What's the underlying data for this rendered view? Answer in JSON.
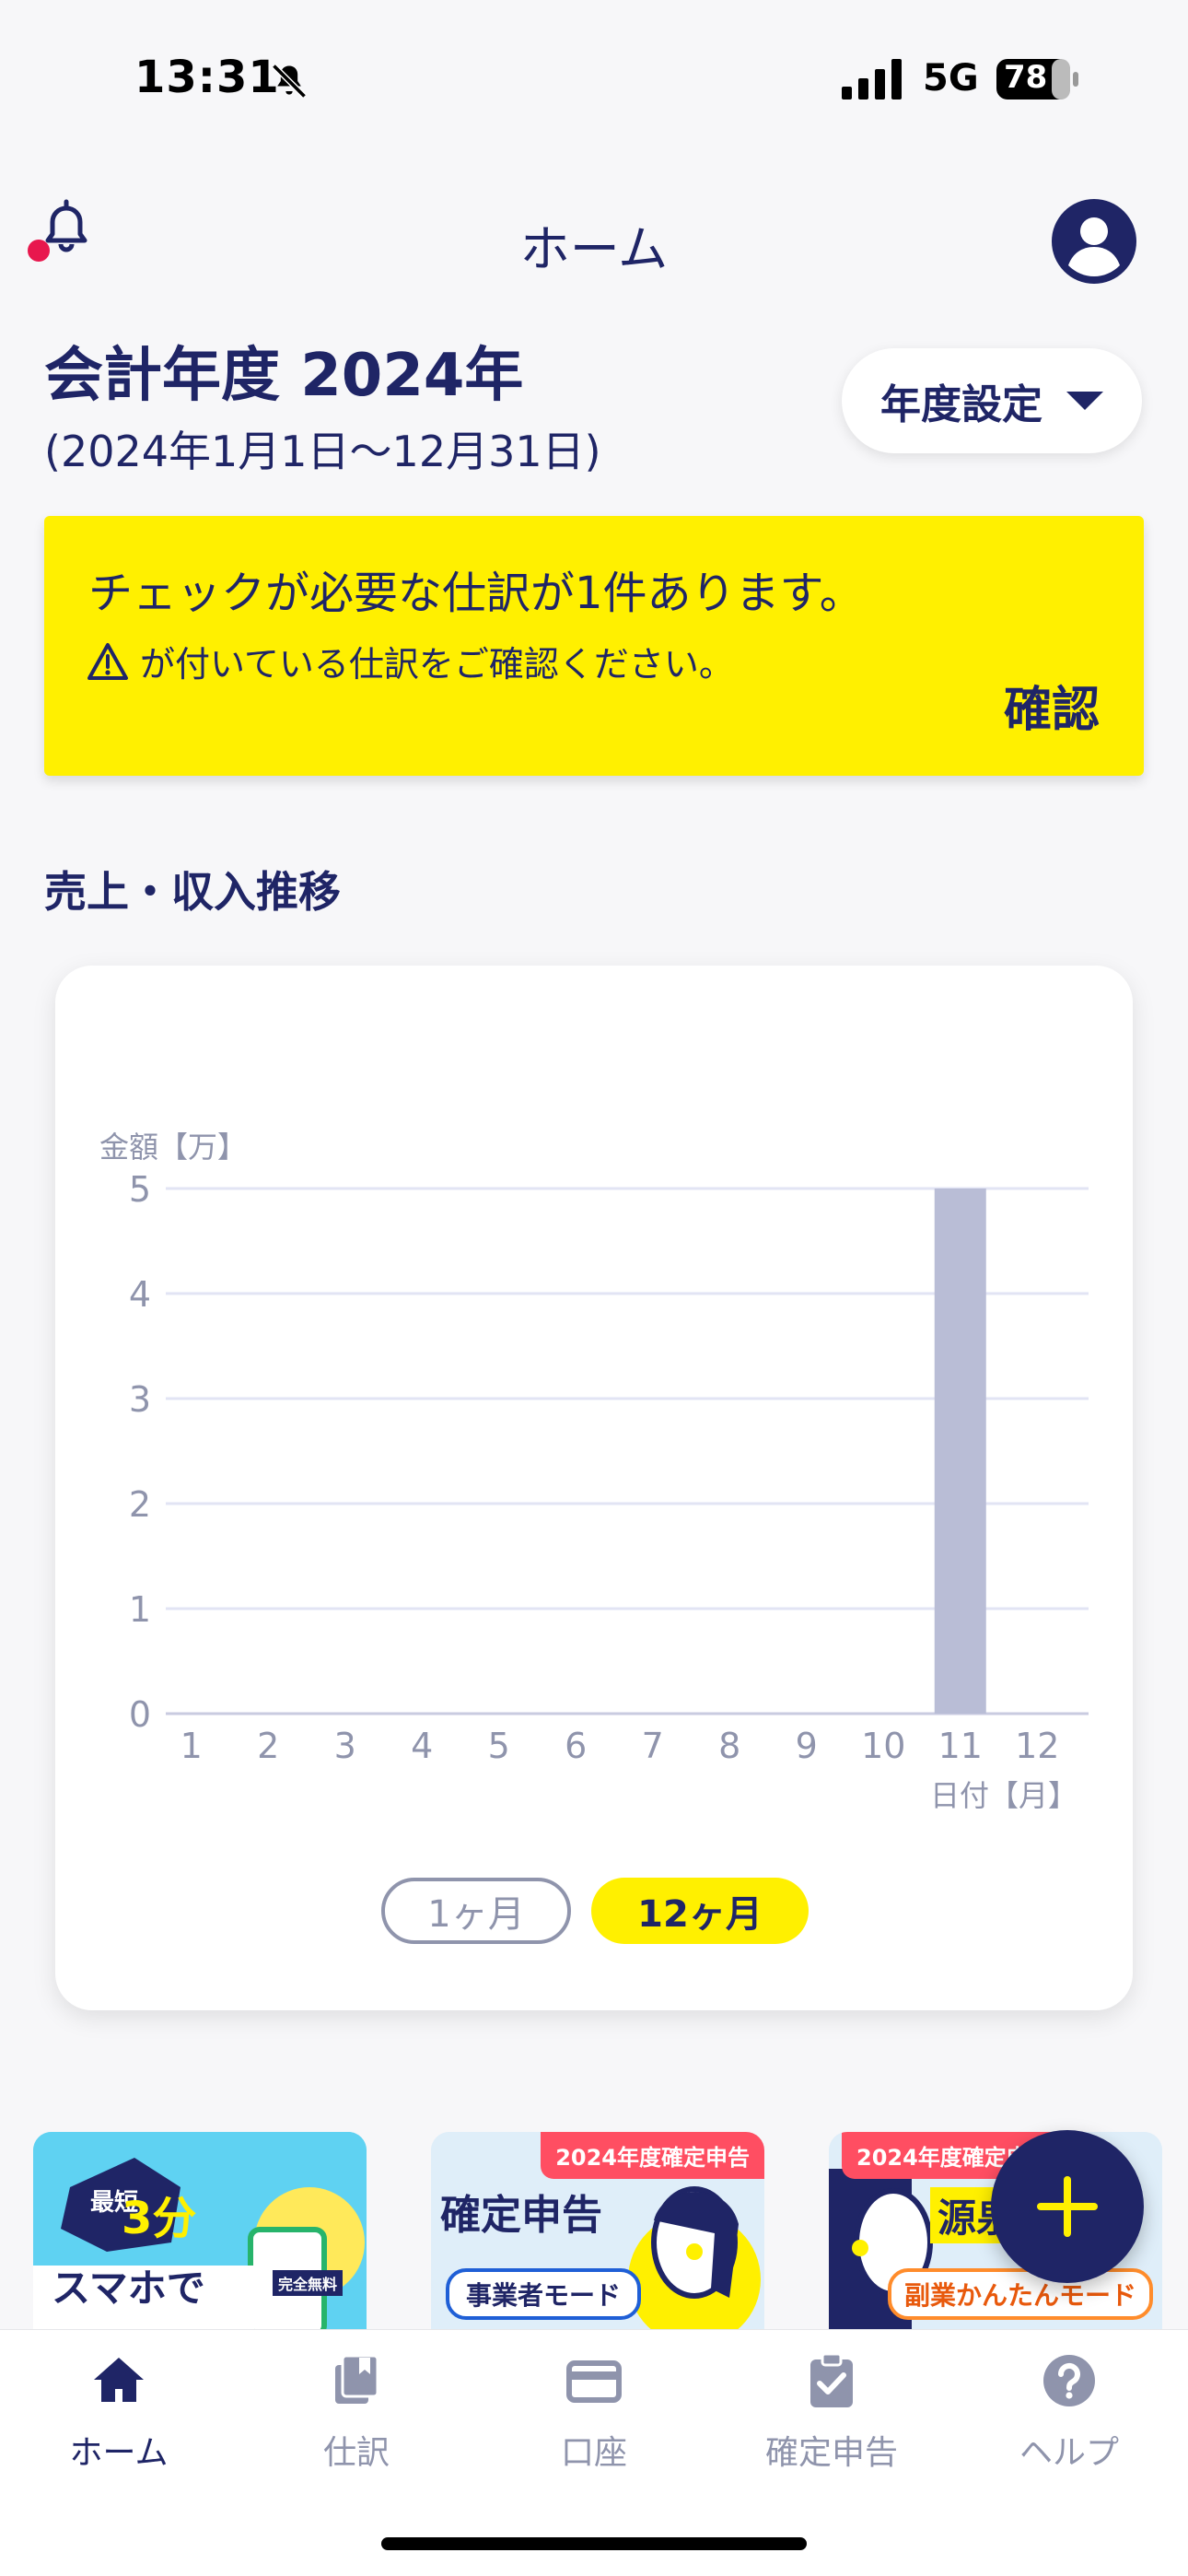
{
  "status_bar": {
    "time": "13:31",
    "network": "5G",
    "battery": "78"
  },
  "header": {
    "title": "ホーム",
    "bell_icon": "bell-icon",
    "avatar_icon": "user-circle-icon"
  },
  "fiscal_year": {
    "title": "会計年度 2024年",
    "range": "(2024年1月1日〜12月31日)",
    "settings_button": "年度設定"
  },
  "alert": {
    "message": "チェックが必要な仕訳が1件あります。",
    "sub_message": "が付いている仕訳をご確認ください。",
    "confirm_label": "確認",
    "color": "#fff000"
  },
  "section": {
    "title": "売上・収入推移"
  },
  "chart_data": {
    "type": "bar",
    "ylabel": "金額【万】",
    "xlabel": "日付【月】",
    "categories": [
      "1",
      "2",
      "3",
      "4",
      "5",
      "6",
      "7",
      "8",
      "9",
      "10",
      "11",
      "12"
    ],
    "values": [
      0,
      0,
      0,
      0,
      0,
      0,
      0,
      0,
      0,
      0,
      5,
      0
    ],
    "yticks": [
      "0",
      "1",
      "2",
      "3",
      "4",
      "5"
    ],
    "ylim": [
      0,
      5
    ],
    "bar_color": "#b9bdd6",
    "grid": true
  },
  "period_toggle": {
    "one_month": "1ヶ月",
    "twelve_months": "12ヶ月",
    "selected": "12ヶ月"
  },
  "banners": [
    {
      "name": "smartphone-banner",
      "text_a": "最短",
      "text_b": "3分",
      "text_c": "スマホで",
      "text_d": "完全無料"
    },
    {
      "name": "business-mode-banner",
      "badge": "2024年度確定申告",
      "title": "確定申告",
      "mode": "事業者モード"
    },
    {
      "name": "side-job-mode-banner",
      "badge": "2024年度確定申告",
      "title": "源泉",
      "mode": "副業かんたんモード"
    }
  ],
  "nav": {
    "items": [
      {
        "label": "ホーム",
        "icon": "home-icon",
        "active": true
      },
      {
        "label": "仕訳",
        "icon": "journal-icon",
        "active": false
      },
      {
        "label": "口座",
        "icon": "card-icon",
        "active": false
      },
      {
        "label": "確定申告",
        "icon": "clipboard-check-icon",
        "active": false
      },
      {
        "label": "ヘルプ",
        "icon": "help-icon",
        "active": false
      }
    ]
  }
}
